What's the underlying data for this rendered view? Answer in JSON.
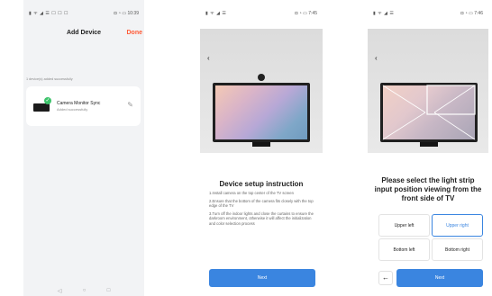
{
  "screen1": {
    "status_left": "▮ ᯤ ◢ ☰ ☐ ☐ ☐",
    "status_right": "◘ ◔ ▭ 10:39",
    "title": "Add Device",
    "done_label": "Done",
    "summary": "1 device(s) added successfully",
    "device": {
      "name": "Camera Monitor Sync",
      "status": "Added successfully"
    },
    "nav": [
      "◁",
      "○",
      "□"
    ]
  },
  "screen2": {
    "status_left": "▮ ᯤ ◢ ☰",
    "status_right": "◘ ◔ ▭ 7:45",
    "back": "‹",
    "heading": "Device setup instruction",
    "steps": [
      "1.Install camera on the top center of the TV screen",
      "2.Ensure that the bottom of the camera fits closely with the top edge of the TV",
      "3.Turn off the indoor lights and close the curtains to ensure the darkroom environment, otherwise it will affect the initialization and color selection process"
    ],
    "next_label": "Next"
  },
  "screen3": {
    "status_left": "▮ ᯤ ◢ ☰",
    "status_right": "◘ ◔ ▭ 7:46",
    "back": "‹",
    "heading_line1": "Please select the light strip",
    "heading_line2": "input position viewing from the",
    "heading_line3": "front side of TV",
    "options": {
      "upper_left": "Upper left",
      "upper_right": "Upper right",
      "bottom_left": "Bottom left",
      "bottom_right": "Bottom right"
    },
    "selected": "upper_right",
    "back_arrow": "←",
    "next_label": "Next"
  },
  "colors": {
    "accent": "#3a85e0",
    "done": "#ff5a36",
    "success": "#3cc36a"
  }
}
